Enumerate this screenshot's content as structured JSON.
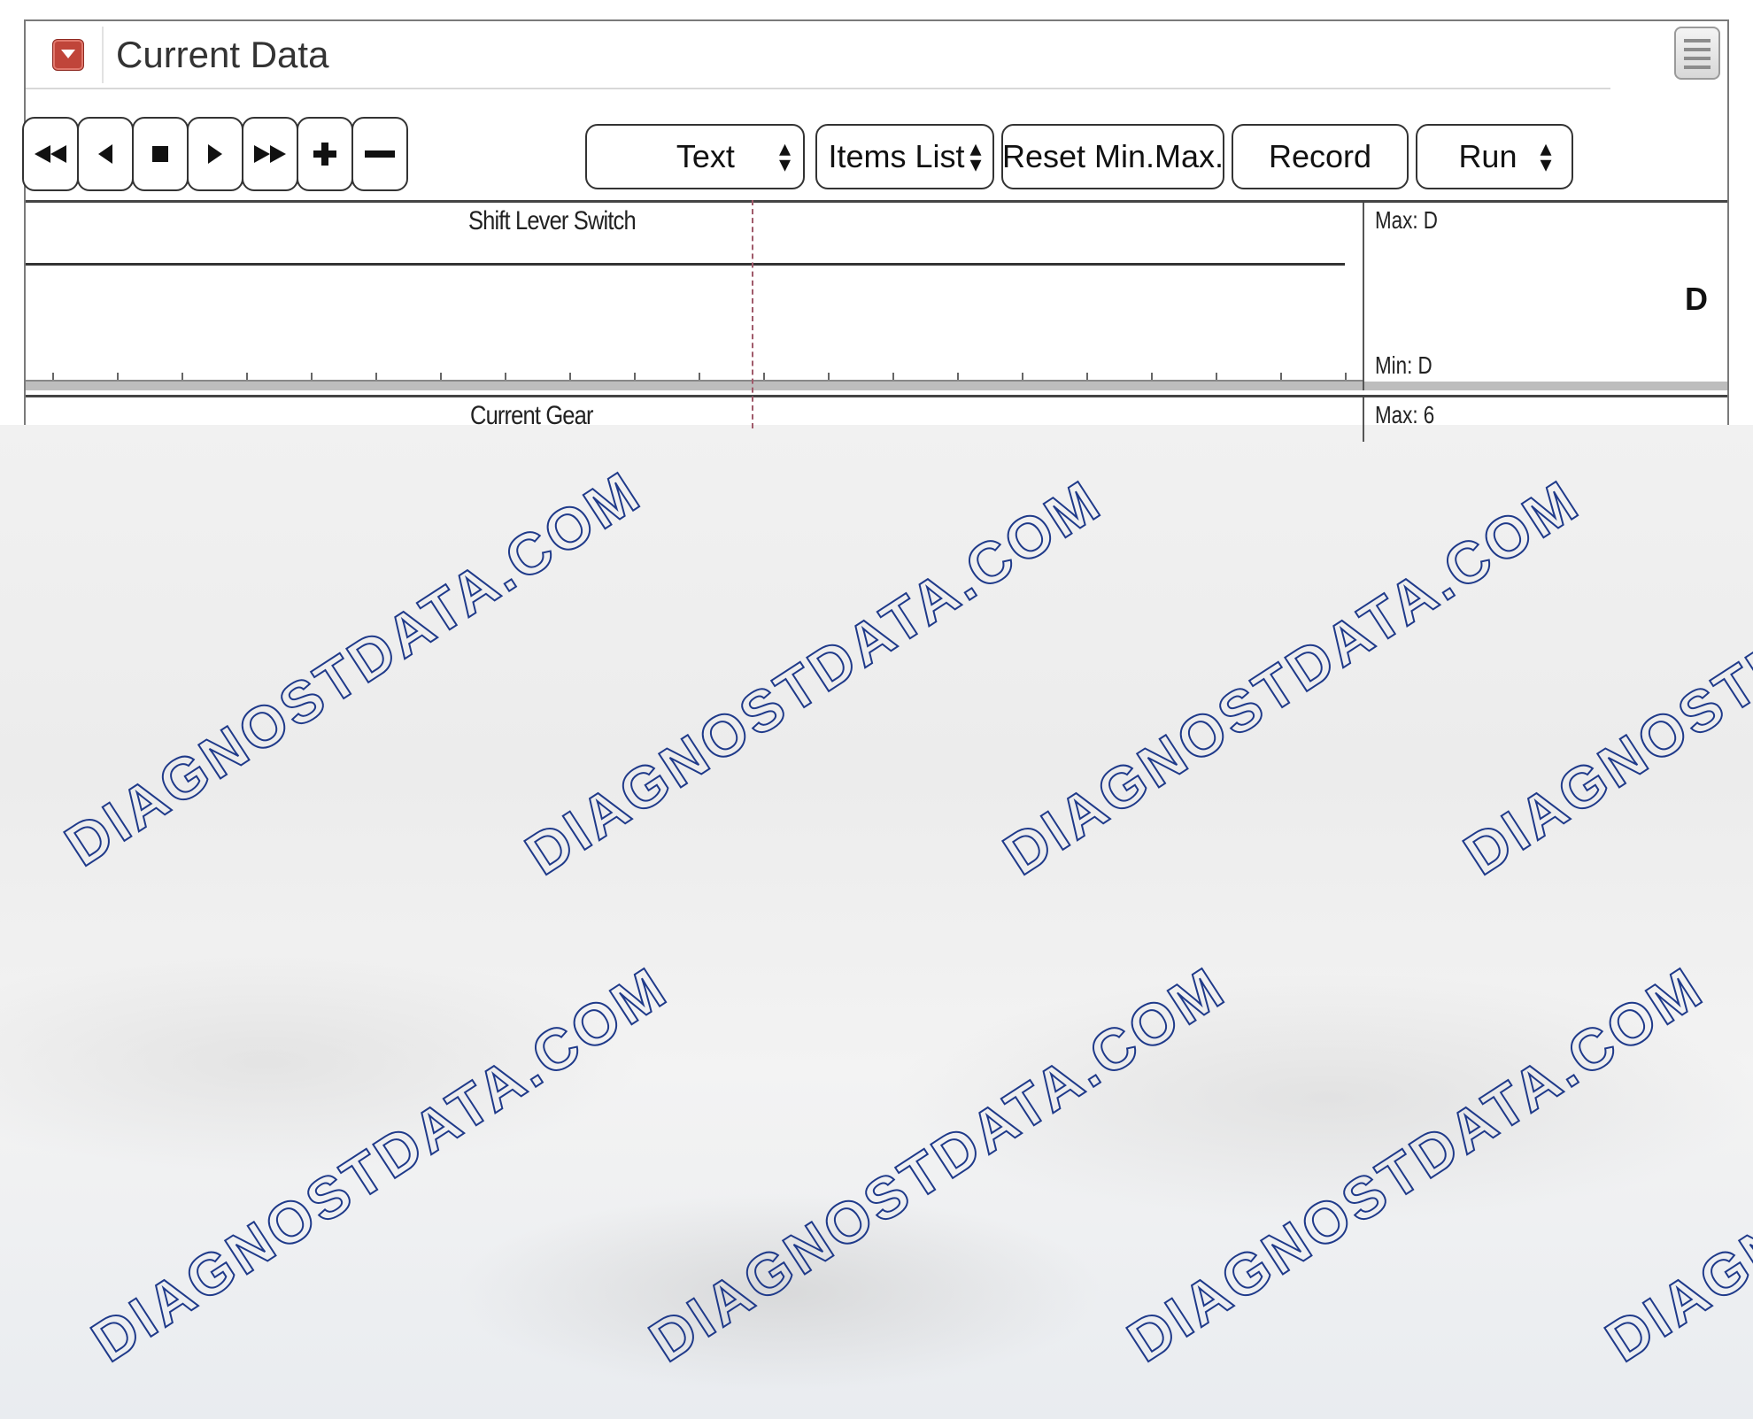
{
  "window": {
    "title": "Current Data"
  },
  "icons": {
    "collapse": "collapse-down-icon",
    "menu": "hamburger-menu-icon",
    "nav": [
      "rewind-icon",
      "step-back-icon",
      "stop-icon",
      "play-icon",
      "fast-forward-icon",
      "zoom-in-icon",
      "zoom-out-icon"
    ]
  },
  "toolbar": {
    "view_select": "Text",
    "items_list": "Items List",
    "reset_minmax": "Reset Min.Max.",
    "record": "Record",
    "run_select": "Run"
  },
  "panels": [
    {
      "name": "Shift Lever Switch",
      "max": "Max: D",
      "min": "Min: D",
      "value": "D"
    },
    {
      "name": "Current Gear",
      "max": "Max: 6"
    }
  ],
  "watermark": {
    "text": "DIAGNOSTDATA.COM",
    "color": "#1f3a8a"
  }
}
